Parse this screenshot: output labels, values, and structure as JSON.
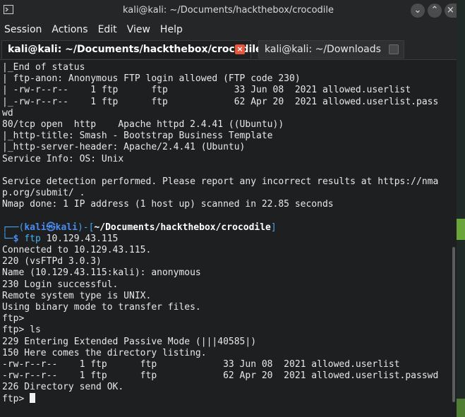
{
  "window": {
    "title": "kali@kali: ~/Documents/hackthebox/crocodile"
  },
  "menu": [
    "Session",
    "Actions",
    "Edit",
    "View",
    "Help"
  ],
  "tabs": [
    {
      "label": "kali@kali: ~/Documents/hackthebox/crocodile",
      "active": true
    },
    {
      "label": "kali@kali: ~/Downloads",
      "active": false
    }
  ],
  "terminal": {
    "lines_before": [
      "|_End of status",
      "| ftp-anon: Anonymous FTP login allowed (FTP code 230)",
      "| -rw-r--r--    1 ftp      ftp            33 Jun 08  2021 allowed.userlist",
      "|_-rw-r--r--    1 ftp      ftp            62 Apr 20  2021 allowed.userlist.pass",
      "wd",
      "80/tcp open  http    Apache httpd 2.4.41 ((Ubuntu))",
      "|_http-title: Smash - Bootstrap Business Template",
      "|_http-server-header: Apache/2.4.41 (Ubuntu)",
      "Service Info: OS: Unix",
      "",
      "Service detection performed. Please report any incorrect results at https://nma",
      "p.org/submit/ .",
      "Nmap done: 1 IP address (1 host up) scanned in 22.85 seconds",
      ""
    ],
    "prompt": {
      "frame_top": "┌──(",
      "user": "kali㉿kali",
      "mid": ")-[",
      "path": "~/Documents/hackthebox/crocodile",
      "end": "]",
      "frame_bottom": "└─",
      "dollar": "$",
      "command": "ftp",
      "args": " 10.129.43.115"
    },
    "lines_after": [
      "Connected to 10.129.43.115.",
      "220 (vsFTPd 3.0.3)",
      "Name (10.129.43.115:kali): anonymous",
      "230 Login successful.",
      "Remote system type is UNIX.",
      "Using binary mode to transfer files.",
      "ftp>",
      "ftp> ls",
      "229 Entering Extended Passive Mode (|||40585|)",
      "150 Here comes the directory listing.",
      "-rw-r--r--    1 ftp      ftp            33 Jun 08  2021 allowed.userlist",
      "-rw-r--r--    1 ftp      ftp            62 Apr 20  2021 allowed.userlist.passwd",
      "226 Directory send OK."
    ],
    "current_prompt": "ftp> "
  },
  "colors": {
    "background": "#1d1f21",
    "prompt_blue": "#4a8cf0",
    "close_tab": "#e9553a"
  }
}
